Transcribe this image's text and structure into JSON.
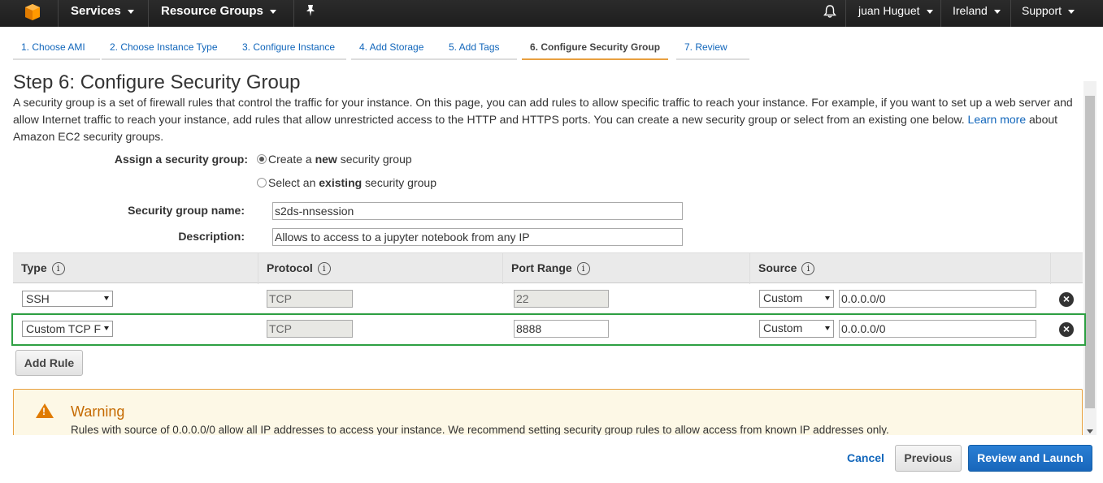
{
  "topnav": {
    "services": "Services",
    "resource_groups": "Resource Groups",
    "user": "juan Huguet",
    "region": "Ireland",
    "support": "Support"
  },
  "tabs": [
    {
      "label": "1. Choose AMI"
    },
    {
      "label": "2. Choose Instance Type"
    },
    {
      "label": "3. Configure Instance"
    },
    {
      "label": "4. Add Storage"
    },
    {
      "label": "5. Add Tags"
    },
    {
      "label": "6. Configure Security Group",
      "active": true
    },
    {
      "label": "7. Review"
    }
  ],
  "page": {
    "title": "Step 6: Configure Security Group",
    "intro_text": "A security group is a set of firewall rules that control the traffic for your instance. On this page, you can add rules to allow specific traffic to reach your instance. For example, if you want to set up a web server and allow Internet traffic to reach your instance, add rules that allow unrestricted access to the HTTP and HTTPS ports. You can create a new security group or select from an existing one below.",
    "learn_more": "Learn more",
    "intro_tail": "about Amazon EC2 security groups."
  },
  "assign": {
    "label": "Assign a security group:",
    "option_new_pre": "Create a ",
    "option_new_bold": "new",
    "option_new_post": " security group",
    "option_existing_pre": "Select an ",
    "option_existing_bold": "existing",
    "option_existing_post": " security group",
    "selected": "new"
  },
  "form": {
    "name_label": "Security group name:",
    "name_value": "s2ds-nnsession",
    "desc_label": "Description:",
    "desc_value": "Allows to access to a jupyter notebook from any IP"
  },
  "table": {
    "headers": {
      "type": "Type",
      "protocol": "Protocol",
      "port_range": "Port Range",
      "source": "Source"
    },
    "rows": [
      {
        "type": "SSH",
        "protocol": "TCP",
        "port": "22",
        "source_mode": "Custom",
        "source_cidr": "0.0.0.0/0"
      },
      {
        "type": "Custom TCP F",
        "protocol": "TCP",
        "port": "8888",
        "source_mode": "Custom",
        "source_cidr": "0.0.0.0/0"
      }
    ]
  },
  "add_rule": "Add Rule",
  "warning": {
    "title": "Warning",
    "text": "Rules with source of 0.0.0.0/0 allow all IP addresses to access your instance. We recommend setting security group rules to allow access from known IP addresses only."
  },
  "footer": {
    "cancel": "Cancel",
    "previous": "Previous",
    "review_launch": "Review and Launch"
  }
}
